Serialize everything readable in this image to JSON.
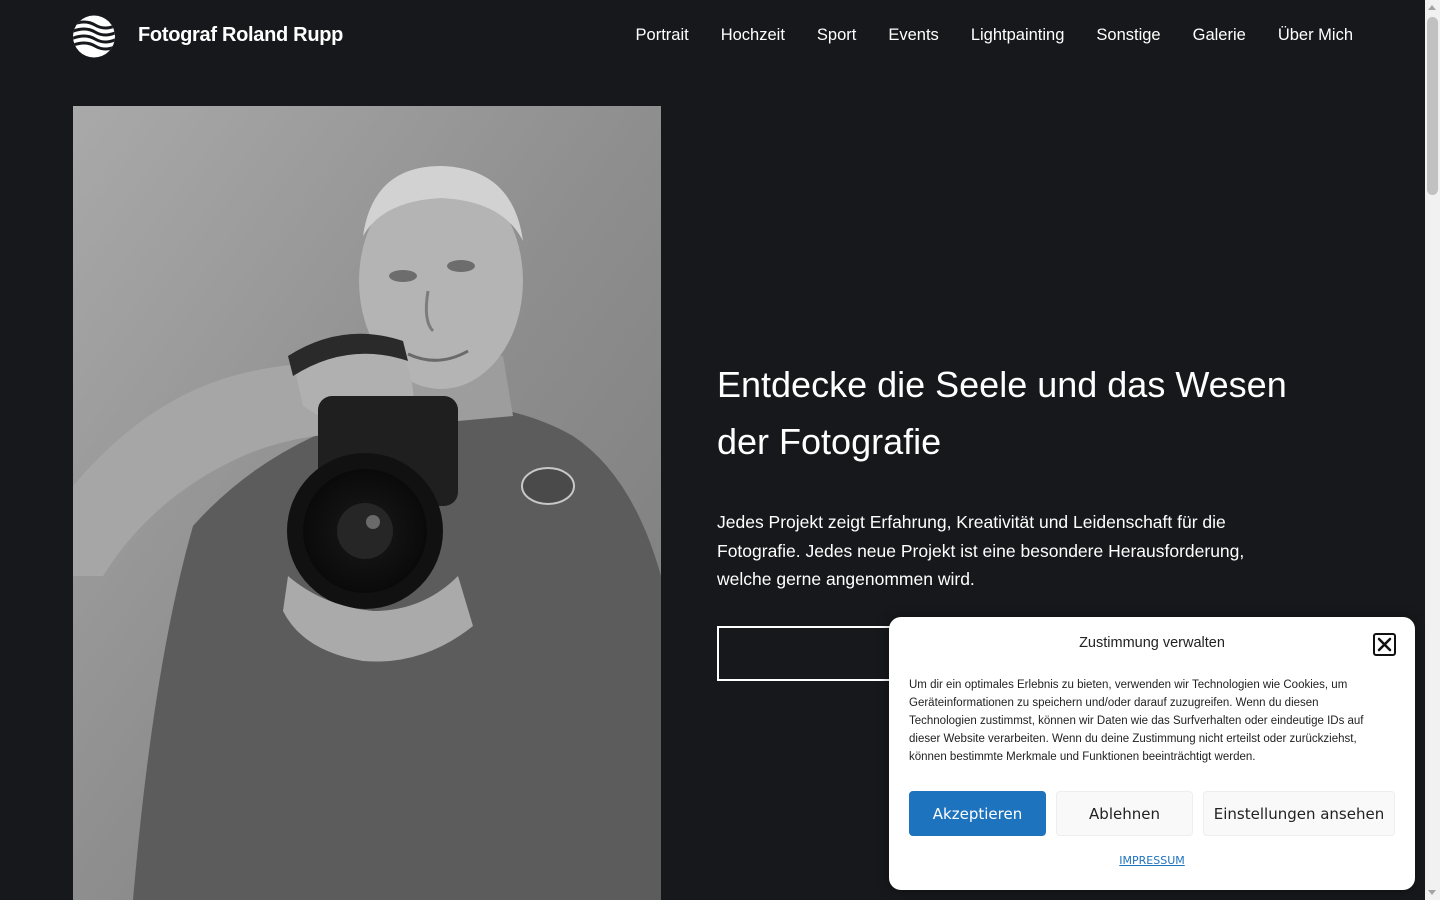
{
  "header": {
    "site_title": "Fotograf Roland Rupp",
    "logo_icon": "striped-globe-logo"
  },
  "nav": {
    "items": [
      {
        "label": "Portrait"
      },
      {
        "label": "Hochzeit"
      },
      {
        "label": "Sport"
      },
      {
        "label": "Events"
      },
      {
        "label": "Lightpainting"
      },
      {
        "label": "Sonstige"
      },
      {
        "label": "Galerie"
      },
      {
        "label": "Über Mich"
      }
    ]
  },
  "hero": {
    "heading": "Entdecke die Seele und das Wesen der Fotografie",
    "text": "Jedes Projekt zeigt Erfahrung, Kreativität und Leidenschaft für die Fotografie. Jedes neue Projekt ist eine besondere Herausforderung, welche gerne angenommen wird.",
    "button_label": ""
  },
  "cookie_banner": {
    "title": "Zustimmung verwalten",
    "close_icon": "close-icon",
    "body": "Um dir ein optimales Erlebnis zu bieten, verwenden wir Technologien wie Cookies, um Geräteinformationen zu speichern und/oder darauf zuzugreifen. Wenn du diesen Technologien zustimmst, können wir Daten wie das Surfverhalten oder eindeutige IDs auf dieser Website verarbeiten. Wenn du deine Zustimmung nicht erteilst oder zurückziehst, können bestimmte Merkmale und Funktionen beeinträchtigt werden.",
    "accept_label": "Akzeptieren",
    "deny_label": "Ablehnen",
    "settings_label": "Einstellungen ansehen",
    "imprint_link": "IMPRESSUM"
  },
  "colors": {
    "page_background": "#16181b",
    "accent": "#1e73be",
    "text_light": "#ffffff"
  }
}
